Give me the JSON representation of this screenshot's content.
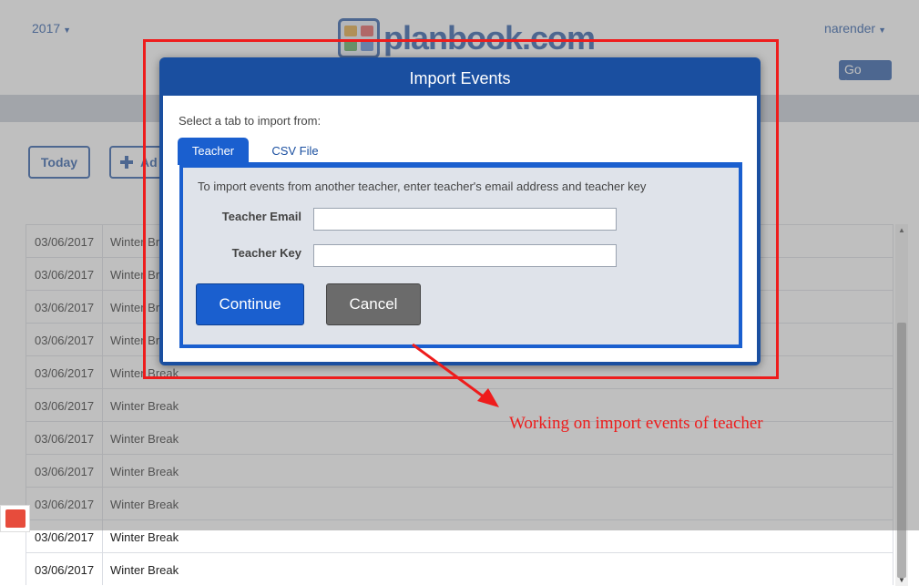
{
  "header": {
    "year_selector": "2017",
    "logo_text": "planbook.com",
    "user_menu": "narender",
    "goto_label": "Go to"
  },
  "toolbar": {
    "today_label": "Today",
    "add_label": "Ad"
  },
  "events": [
    {
      "date": "03/06/2017",
      "name": "Winter Break"
    },
    {
      "date": "03/06/2017",
      "name": "Winter Break"
    },
    {
      "date": "03/06/2017",
      "name": "Winter Break"
    },
    {
      "date": "03/06/2017",
      "name": "Winter Break"
    },
    {
      "date": "03/06/2017",
      "name": "Winter Break"
    },
    {
      "date": "03/06/2017",
      "name": "Winter Break"
    },
    {
      "date": "03/06/2017",
      "name": "Winter Break"
    },
    {
      "date": "03/06/2017",
      "name": "Winter Break"
    },
    {
      "date": "03/06/2017",
      "name": "Winter Break"
    },
    {
      "date": "03/06/2017",
      "name": "Winter Break"
    },
    {
      "date": "03/06/2017",
      "name": "Winter Break"
    }
  ],
  "modal": {
    "title": "Import Events",
    "prompt": "Select a tab to import from:",
    "tabs": [
      {
        "label": "Teacher",
        "active": true
      },
      {
        "label": "CSV File",
        "active": false
      }
    ],
    "info": "To import events from another teacher, enter teacher's email address and teacher key",
    "email_label": "Teacher Email",
    "email_value": "",
    "key_label": "Teacher Key",
    "key_value": "",
    "continue_label": "Continue",
    "cancel_label": "Cancel"
  },
  "annotation": {
    "text": "Working on import events of teacher",
    "color": "#ee1c1c"
  },
  "colors": {
    "brand_blue": "#1a4fa0",
    "tab_active": "#1a5fcf",
    "cancel_gray": "#6b6b6b"
  }
}
